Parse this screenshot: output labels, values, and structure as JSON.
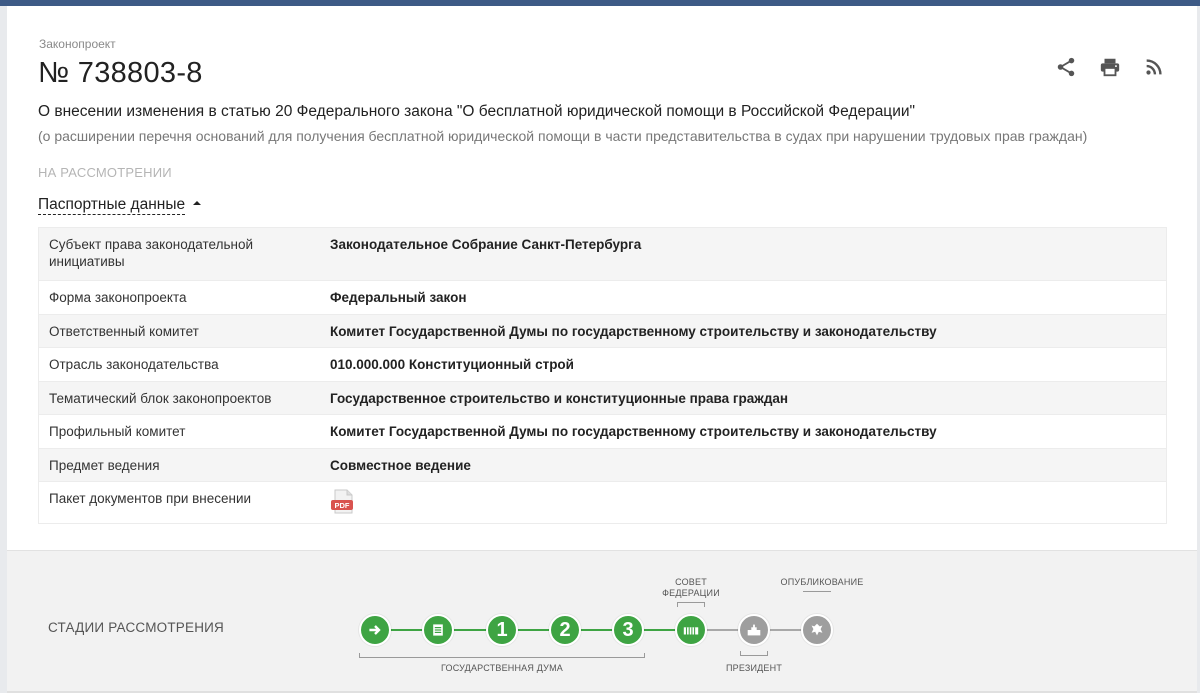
{
  "header": {
    "kind": "Законопроект",
    "number": "№ 738803-8",
    "title": "О внесении изменения в статью 20 Федерального закона \"О бесплатной юридической помощи в Российской Федерации\"",
    "subtitle": "(о расширении перечня оснований для получения бесплатной юридической помощи в части представительства в судах при нарушении трудовых прав граждан)",
    "status": "НА РАССМОТРЕНИИ",
    "actions": [
      {
        "icon": "share-icon"
      },
      {
        "icon": "print-icon"
      },
      {
        "icon": "rss-icon"
      }
    ]
  },
  "passport": {
    "toggle_label": "Паспортные данные",
    "rows": [
      {
        "key": "Субъект права законодательной инициативы",
        "value": "Законодательное Собрание Санкт-Петербурга"
      },
      {
        "key": "Форма законопроекта",
        "value": "Федеральный закон"
      },
      {
        "key": "Ответственный комитет",
        "value": "Комитет Государственной Думы по государственному строительству и законодательству"
      },
      {
        "key": "Отрасль законодательства",
        "value": "010.000.000 Конституционный строй"
      },
      {
        "key": "Тематический блок законопроектов",
        "value": "Государственное строительство и конституционные права граждан"
      },
      {
        "key": "Профильный комитет",
        "value": "Комитет Государственной Думы по государственному строительству и законодательству"
      },
      {
        "key": "Предмет ведения",
        "value": "Совместное ведение"
      },
      {
        "key": "Пакет документов при внесении",
        "value": ""
      }
    ],
    "pdf_label": "PDF"
  },
  "stages": {
    "label": "СТАДИИ РАССМОТРЕНИЯ",
    "steps": [
      {
        "glyph": "➜",
        "state": "done",
        "icon": "arrow-right-icon"
      },
      {
        "glyph": "",
        "state": "done",
        "icon": "document-list-icon"
      },
      {
        "glyph": "1",
        "state": "done",
        "icon": "reading-1-icon"
      },
      {
        "glyph": "2",
        "state": "done",
        "icon": "reading-2-icon"
      },
      {
        "glyph": "3",
        "state": "done",
        "icon": "reading-3-icon"
      },
      {
        "glyph": "",
        "state": "done",
        "icon": "federation-council-icon"
      },
      {
        "glyph": "",
        "state": "pending",
        "icon": "president-icon"
      },
      {
        "glyph": "",
        "state": "pending",
        "icon": "publication-icon"
      }
    ],
    "captions": {
      "duma": "ГОСУДАРСТВЕННАЯ ДУМА",
      "council": "СОВЕТ\nФЕДЕРАЦИИ",
      "president": "ПРЕЗИДЕНТ",
      "publication": "ОПУБЛИКОВАНИЕ"
    },
    "colors": {
      "done": "#3ea443",
      "pending": "#9e9e9e"
    }
  }
}
